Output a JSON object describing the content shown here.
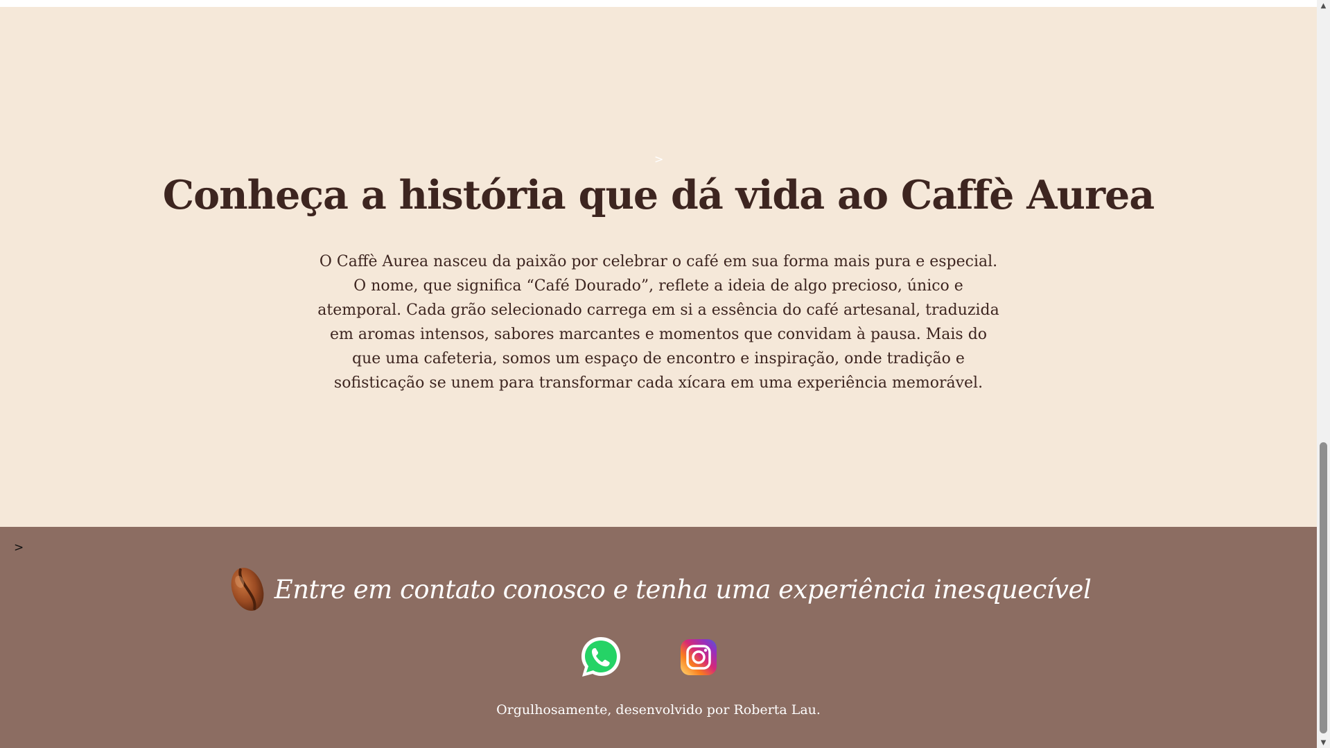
{
  "about": {
    "arrow_marker": ">",
    "title": "Conheça a história que dá vida ao Caffè Aurea",
    "text": "O Caffè Aurea nasceu da paixão por celebrar o café em sua forma mais pura e especial. O nome, que significa “Café Dourado”, reflete a ideia de algo precioso, único e atemporal. Cada grão selecionado carrega em si a essência do café artesanal, traduzida em aromas intensos, sabores marcantes e momentos que convidam à pausa. Mais do que uma cafeteria, somos um espaço de encontro e inspiração, onde tradição e sofisticação se unem para transformar cada xícara em uma experiência memorável."
  },
  "footer": {
    "arrow_marker": ">",
    "contact_title": "Entre em contato conosco e tenha uma experiência inesquecível",
    "icons": {
      "bean": "coffee-bean-icon",
      "whatsapp": "whatsapp-icon",
      "instagram": "instagram-icon"
    },
    "credit": "Orgulhosamente, desenvolvido por Roberta Lau."
  },
  "colors": {
    "page_background": "#f5e8d9",
    "heading_text": "#3d2520",
    "footer_background": "#8c6d62",
    "footer_text": "#ffffff",
    "whatsapp_green": "#25d366"
  },
  "scrollbar": {
    "up_arrow": "▲",
    "down_arrow": "▼"
  }
}
